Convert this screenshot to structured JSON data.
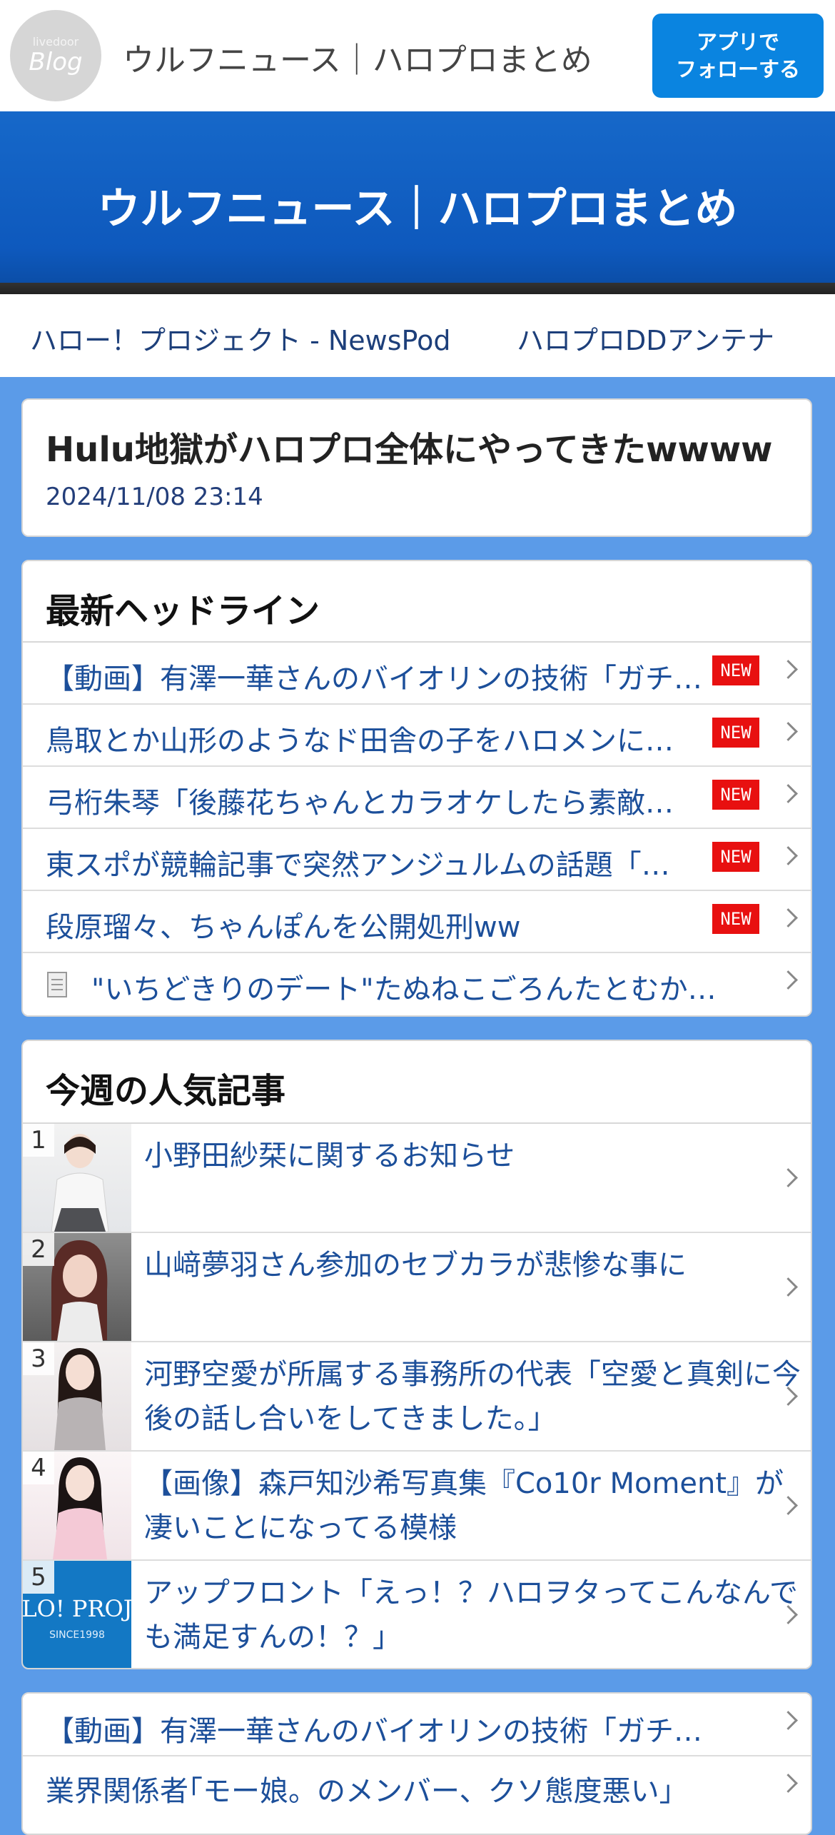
{
  "header": {
    "logo_small": "livedoor",
    "logo_big": "Blog",
    "site_title": "ウルフニュース｜ハロプロまとめ",
    "follow_line1": "アプリで",
    "follow_line2": "フォローする"
  },
  "hero": {
    "title": "ウルフニュース｜ハロプロまとめ"
  },
  "links": [
    "ハロー！プロジェクト - NewsPod",
    "ハロプロDDアンテナ"
  ],
  "article": {
    "title": "Hulu地獄がハロプロ全体にやってきたwwww",
    "date": "2024/11/08 23:14"
  },
  "headlines": {
    "heading": "最新ヘッドライン",
    "new_label": "NEW",
    "items": [
      "【動画】有澤一華さんのバイオリンの技術「ガチ…",
      "鳥取とか山形のようなド田舎の子をハロメンに…",
      "弓桁朱琴「後藤花ちゃんとカラオケしたら素敵…",
      "東スポが競輪記事で突然アンジュルムの話題「…",
      "段原瑠々、ちゃんぽんを公開処刑ww",
      "\"いちどきりのデート\"たぬねこごろんたとむか…"
    ]
  },
  "ranking": {
    "heading": "今週の人気記事",
    "items": [
      {
        "rank": "1",
        "title": "小野田紗栞に関するお知らせ"
      },
      {
        "rank": "2",
        "title": "山﨑夢羽さん参加のセブカラが悲惨な事に"
      },
      {
        "rank": "3",
        "title": "河野空愛が所属する事務所の代表「空愛と真剣に今後の話し合いをしてきました。」"
      },
      {
        "rank": "4",
        "title": "【画像】森戸知沙希写真集『Co10r Moment』が凄いことになってる模様"
      },
      {
        "rank": "5",
        "title": "アップフロント「えっ！？ハロヲタってこんなんでも満足すんの！？」"
      }
    ],
    "thumb5_text": "LO! PROJ",
    "thumb5_since": "SINCE1998"
  },
  "more": {
    "items": [
      "【動画】有澤一華さんのバイオリンの技術「ガチ…",
      "業界関係者｢モー娘。のメンバー、クソ態度悪い｣"
    ]
  },
  "colors": {
    "accent": "#0a84e0",
    "hero": "#1668c9",
    "page_bg": "#5b9be8",
    "new_badge": "#e81010",
    "link": "#1c4f9a"
  }
}
